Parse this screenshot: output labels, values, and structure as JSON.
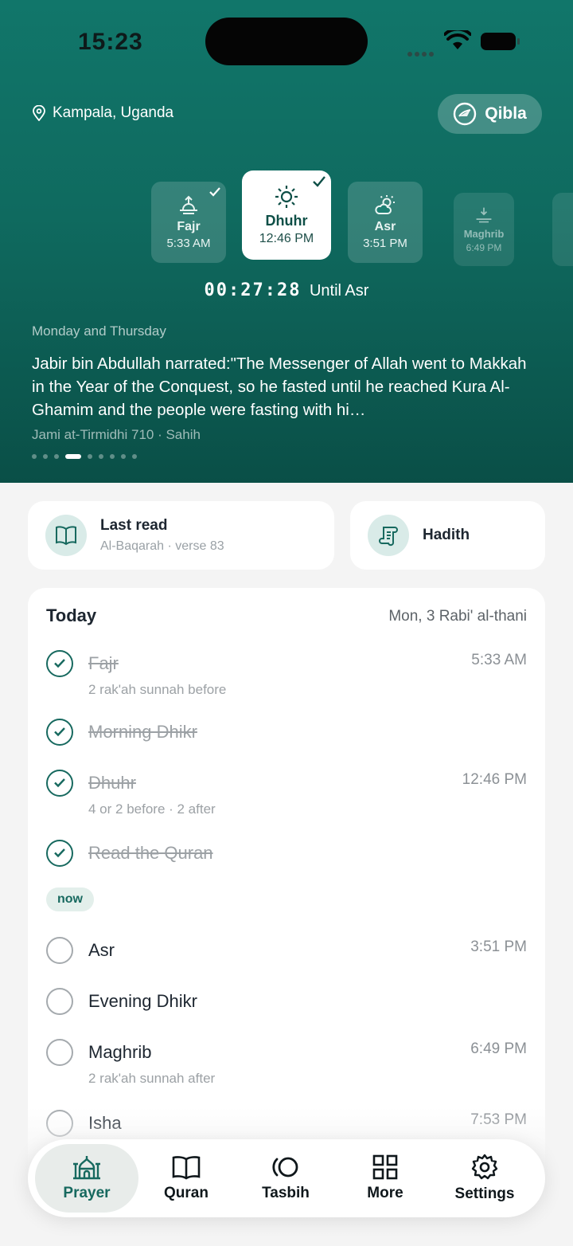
{
  "status_bar": {
    "time": "15:23"
  },
  "header": {
    "location": "Kampala, Uganda",
    "qibla_label": "Qibla"
  },
  "prayer_cards": [
    {
      "name": "Fajr",
      "time": "5:33 AM",
      "state": "done"
    },
    {
      "name": "Dhuhr",
      "time": "12:46 PM",
      "state": "active"
    },
    {
      "name": "Asr",
      "time": "3:51 PM",
      "state": "upcoming"
    },
    {
      "name": "Maghrib",
      "time": "6:49 PM",
      "state": "faded"
    }
  ],
  "countdown": {
    "time": "00:27:28",
    "label": "Until Asr"
  },
  "hadith": {
    "topic": "Monday and Thursday",
    "text": "Jabir bin Abdullah narrated:\"The Messenger of Allah went to Makkah in the Year of the Conquest, so he fasted until he reached Kura Al-Ghamim and the people were fasting with hi…",
    "source": "Jami at-Tirmidhi 710 · Sahih",
    "page_count": 9,
    "current_page": 4
  },
  "quick": {
    "last_read_title": "Last read",
    "last_read_sub": "Al-Baqarah · verse 83",
    "hadith_title": "Hadith"
  },
  "today": {
    "title": "Today",
    "date": "Mon, 3 Rabi' al-thani",
    "now_label": "now",
    "tasks": [
      {
        "name": "Fajr",
        "sub": "2 rak'ah sunnah before",
        "time": "5:33 AM",
        "done": true
      },
      {
        "name": "Morning Dhikr",
        "sub": "",
        "time": "",
        "done": true
      },
      {
        "name": "Dhuhr",
        "sub": "4 or 2 before · 2 after",
        "time": "12:46 PM",
        "done": true
      },
      {
        "name": "Read the Quran",
        "sub": "",
        "time": "",
        "done": true
      },
      {
        "name": "Asr",
        "sub": "",
        "time": "3:51 PM",
        "done": false
      },
      {
        "name": "Evening Dhikr",
        "sub": "",
        "time": "",
        "done": false
      },
      {
        "name": "Maghrib",
        "sub": "2 rak'ah sunnah after",
        "time": "6:49 PM",
        "done": false
      },
      {
        "name": "Isha",
        "sub": "",
        "time": "7:53 PM",
        "done": false
      }
    ]
  },
  "tabbar": {
    "tabs": [
      {
        "label": "Prayer",
        "icon": "mosque-icon",
        "active": true
      },
      {
        "label": "Quran",
        "icon": "book-open-icon",
        "active": false
      },
      {
        "label": "Tasbih",
        "icon": "tasbih-icon",
        "active": false
      },
      {
        "label": "More",
        "icon": "grid-icon",
        "active": false
      },
      {
        "label": "Settings",
        "icon": "gear-icon",
        "active": false
      }
    ]
  },
  "colors": {
    "accent": "#17695f",
    "hero_top": "#11766a",
    "hero_bottom": "#0a4f47"
  }
}
